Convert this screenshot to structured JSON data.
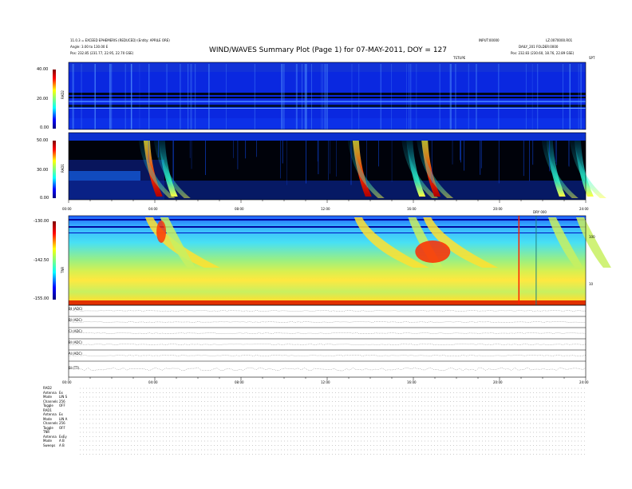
{
  "header": {
    "title": "WIND/WAVES Summary Plot (Page 1) for 07-MAY-2011, DOY = 127",
    "left_line1": "11.0.3 = EXCEED EPHEMERIS (REDUCED) (Entity: APRILE ORE)",
    "left_line2": "Angle: 3.00 to 130.00 E",
    "left_orbit_label": "Pos:",
    "left_orbit_value": "232.85 (231.77, 22.95, 22.70 GSE)",
    "right_line1": "INPUT:00000",
    "right_line2": "LZ.0070000.R01",
    "right_line3": "DAILY_201 FOLDER:0000",
    "right_orbit_label": "Pos:",
    "right_orbit_value": "232.83 (230.60, 18.76, 22.89 GSE)",
    "right_mark": "SPT",
    "center_mark": "TSTUPE"
  },
  "panels": {
    "rad2": {
      "name": "RAD2",
      "ticks": [
        "40.00",
        "20.00",
        "0.00"
      ]
    },
    "rad1": {
      "name": "RAD1",
      "ticks": [
        "50.00",
        "30.00",
        "0.00"
      ]
    },
    "tnr": {
      "name": "TNR",
      "ticks": [
        "-130.00",
        "-142.50",
        "-155.00"
      ],
      "right_ticks": [
        "100",
        "10"
      ],
      "marker": "DRY 000"
    },
    "traces": [
      "Bt (ADC)",
      "Bl (ADC)",
      "Cl (ADC)",
      "Bl (ADC)",
      "Al (ADC)",
      "Bl (TT)"
    ]
  },
  "time_axis": [
    "00:00",
    "04:00",
    "08:00",
    "12:00",
    "16:00",
    "20:00",
    "24:00"
  ],
  "receivers": [
    {
      "name": "RAD2",
      "rows": [
        [
          "Antenna",
          "Ex"
        ],
        [
          "Mode",
          "LIN S"
        ],
        [
          "Channels",
          "256"
        ],
        [
          "Toggle",
          "OFF"
        ]
      ]
    },
    {
      "name": "RAD1",
      "rows": [
        [
          "Antenna",
          "Ex"
        ],
        [
          "Mode",
          "LIN A"
        ],
        [
          "Channels",
          "256"
        ],
        [
          "Toggle",
          "OFF"
        ]
      ]
    },
    {
      "name": "TNR",
      "rows": [
        [
          "Antenna",
          "ExEy"
        ],
        [
          "Mode",
          "A B"
        ],
        [
          "Sweeps",
          "A B"
        ]
      ]
    }
  ],
  "chart_data": {
    "type": "heatmap",
    "title": "WIND/WAVES Summary Plot (Page 1) for 07-MAY-2011, DOY = 127",
    "x": {
      "label": "",
      "range": [
        "00:00",
        "24:00"
      ],
      "ticks": [
        "00:00",
        "04:00",
        "08:00",
        "12:00",
        "16:00",
        "20:00",
        "24:00"
      ]
    },
    "colormap": "jet",
    "panels": [
      {
        "name": "RAD2",
        "zrange": [
          0,
          40
        ],
        "zticks": [
          0,
          20,
          40
        ]
      },
      {
        "name": "RAD1",
        "zrange": [
          0,
          50
        ],
        "zticks": [
          0,
          30,
          50
        ]
      },
      {
        "name": "TNR",
        "zrange": [
          -155,
          -130
        ],
        "zticks": [
          -155,
          -142.5,
          -130
        ]
      }
    ],
    "radio_bursts_hours": [
      3.7,
      4.4,
      13.4,
      15.9,
      16.6,
      22.4,
      23.7
    ]
  }
}
